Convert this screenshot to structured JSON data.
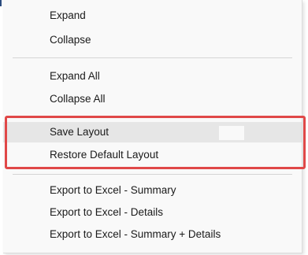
{
  "menu": {
    "group1": [
      "Expand",
      "Collapse"
    ],
    "group2": [
      "Expand All",
      "Collapse All"
    ],
    "group3": [
      "Save Layout",
      "Restore Default Layout"
    ],
    "group4": [
      "Export to Excel - Summary",
      "Export to Excel - Details",
      "Export to Excel - Summary + Details"
    ]
  },
  "colors": {
    "highlight_border": "#e04848",
    "hover_background": "#e6e6e6",
    "menu_background": "#f9f9f9"
  }
}
